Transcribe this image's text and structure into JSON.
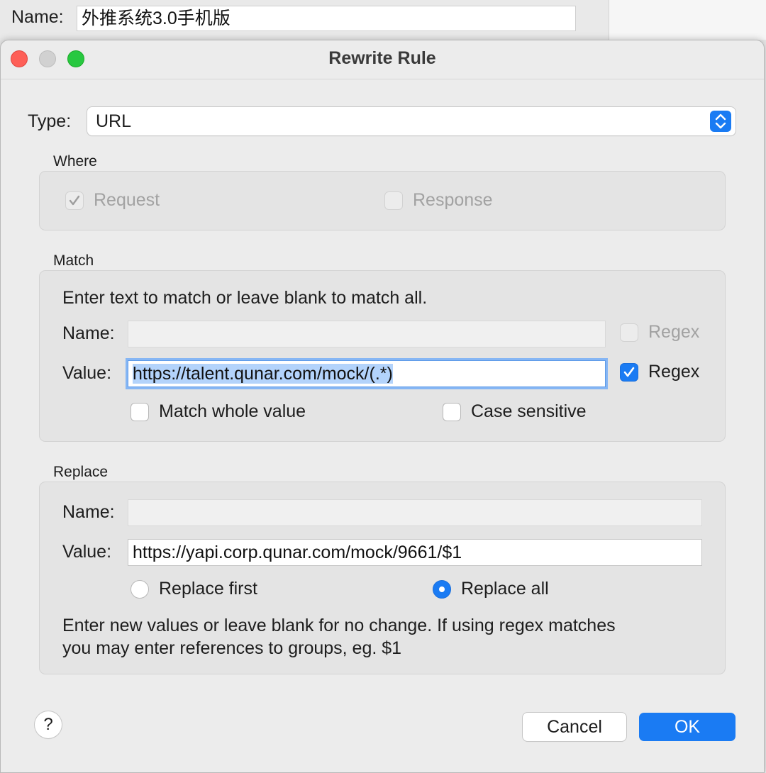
{
  "parent": {
    "name_label": "Name:",
    "name_value": "外推系统3.0手机版"
  },
  "dialog": {
    "title": "Rewrite Rule",
    "type_label": "Type:",
    "type_value": "URL",
    "where": {
      "title": "Where",
      "request_label": "Request",
      "request_checked": true,
      "response_label": "Response",
      "response_checked": false
    },
    "match": {
      "title": "Match",
      "hint": "Enter text to match or leave blank to match all.",
      "name_label": "Name:",
      "name_value": "",
      "name_regex_label": "Regex",
      "name_regex_checked": false,
      "value_label": "Value:",
      "value_value": "https://talent.qunar.com/mock/(.*)",
      "value_regex_label": "Regex",
      "value_regex_checked": true,
      "match_whole_label": "Match whole value",
      "match_whole_checked": false,
      "case_sensitive_label": "Case sensitive",
      "case_sensitive_checked": false
    },
    "replace": {
      "title": "Replace",
      "name_label": "Name:",
      "name_value": "",
      "value_label": "Value:",
      "value_value": "https://yapi.corp.qunar.com/mock/9661/$1",
      "replace_first_label": "Replace first",
      "replace_all_label": "Replace all",
      "selected_mode": "Replace all",
      "hint_line1": "Enter new values or leave blank for no change. If using regex matches",
      "hint_line2": "you may enter references to groups, eg. $1"
    },
    "help_label": "?",
    "cancel_label": "Cancel",
    "ok_label": "OK"
  },
  "colors": {
    "accent": "#1a7bf3",
    "close": "#fe5f57",
    "minimize": "#d1d1d1",
    "zoom": "#28c840"
  }
}
